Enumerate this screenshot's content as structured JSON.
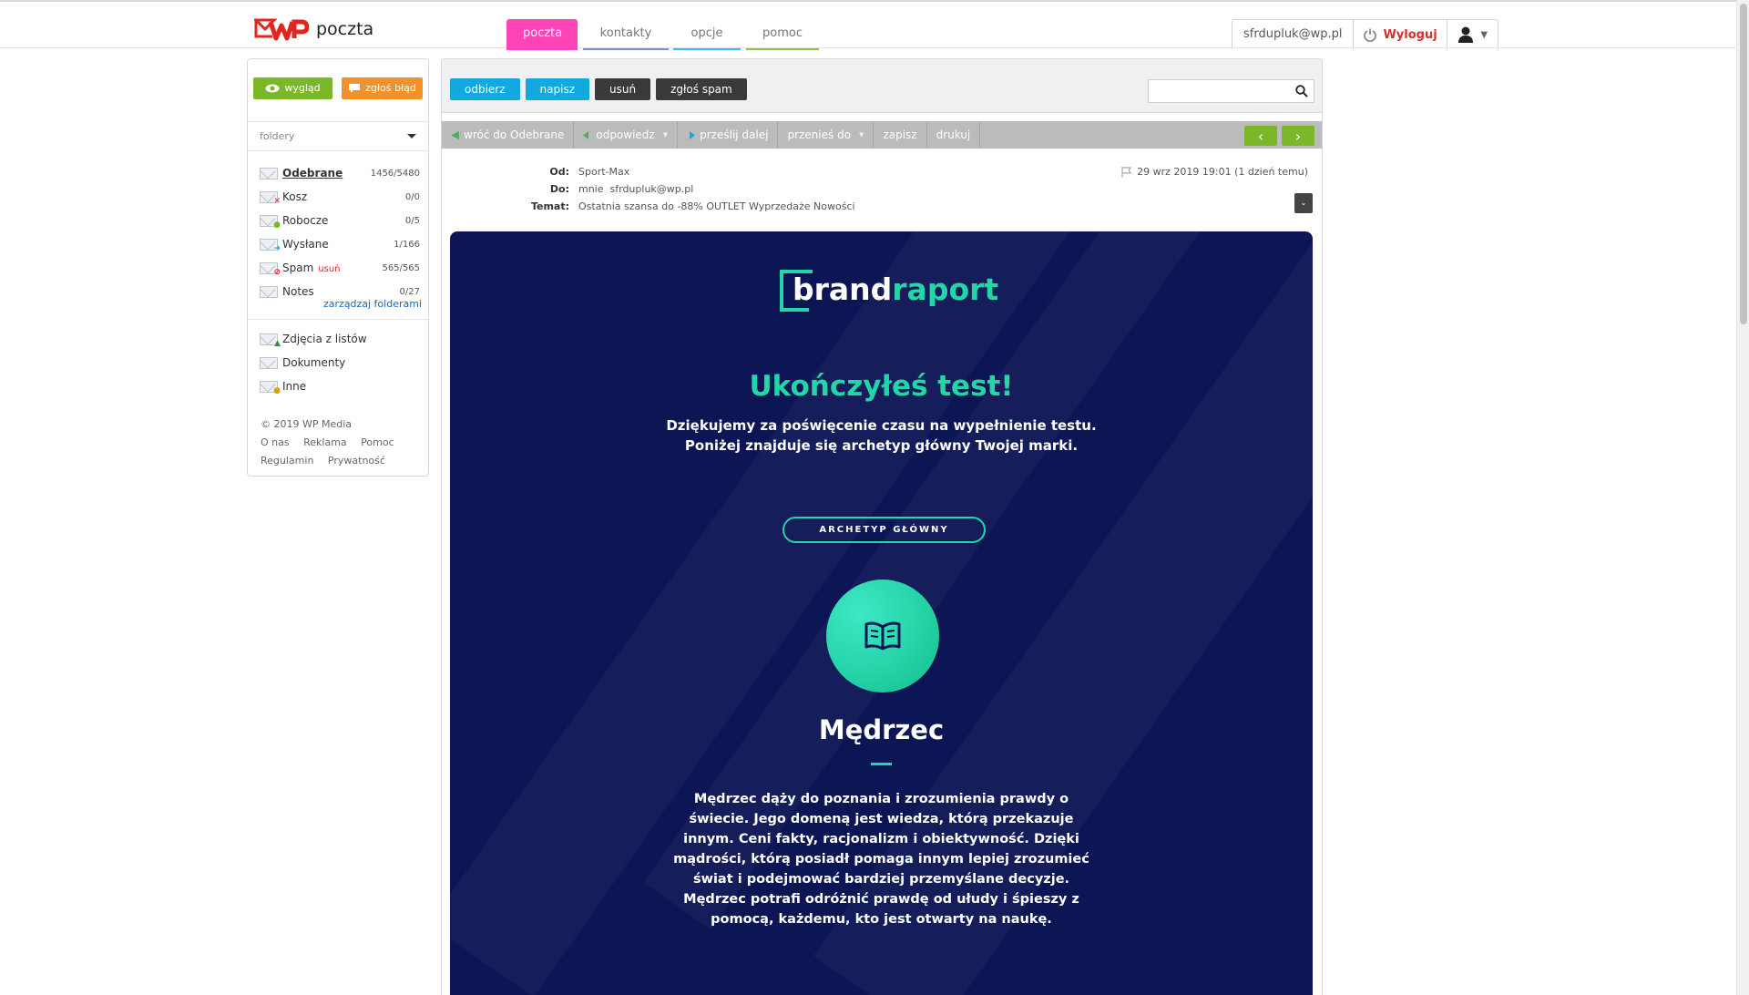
{
  "brand": {
    "name": "poczta"
  },
  "nav_tabs": [
    {
      "label": "poczta"
    },
    {
      "label": "kontakty"
    },
    {
      "label": "opcje"
    },
    {
      "label": "pomoc"
    }
  ],
  "account": {
    "email": "sfrdupluk@wp.pl",
    "logout_label": "Wyloguj"
  },
  "sidebar": {
    "view_button": "wygląd",
    "report_button": "zgłoś błąd",
    "folders_label": "foldery",
    "folders": [
      {
        "name": "Odebrane",
        "count": "1456/5480",
        "icon": "inbox-icon"
      },
      {
        "name": "Kosz",
        "count": "0/0",
        "icon": "trash-icon"
      },
      {
        "name": "Robocze",
        "count": "0/5",
        "icon": "drafts-icon"
      },
      {
        "name": "Wysłane",
        "count": "1/166",
        "icon": "sent-icon"
      },
      {
        "name": "Spam",
        "count": "565/565",
        "icon": "spam-icon",
        "action": "usuń"
      },
      {
        "name": "Notes",
        "count": "0/27",
        "icon": "notes-icon"
      }
    ],
    "manage_folders": "zarządzaj folderami",
    "extra_folders": [
      {
        "name": "Zdjęcia z listów",
        "icon": "photos-icon"
      },
      {
        "name": "Dokumenty",
        "icon": "documents-icon"
      },
      {
        "name": "Inne",
        "icon": "other-icon"
      }
    ],
    "copyright": "© 2019 WP Media",
    "footer_links": [
      "O nas",
      "Reklama",
      "Pomoc",
      "Regulamin",
      "Prywatność"
    ]
  },
  "toolbar": {
    "receive": "odbierz",
    "compose": "napisz",
    "delete": "usuń",
    "report_spam": "zgłoś spam",
    "search_placeholder": ""
  },
  "actions": {
    "back": "wróć do Odebrane",
    "reply": "odpowiedz",
    "forward": "prześlij dalej",
    "move": "przenieś do",
    "save": "zapisz",
    "print": "drukuj"
  },
  "message": {
    "from_label": "Od:",
    "from": "Sport-Max",
    "to_label": "Do:",
    "to_me": "mnie",
    "to_address": "sfrdupluk@wp.pl",
    "subject_label": "Temat:",
    "subject": "Ostatnia szansa do -88% OUTLET Wyprzedaże Nowości",
    "date": "29 wrz 2019 19:01 (1 dzień temu)"
  },
  "email_content": {
    "logo_part1": "brand",
    "logo_part2": "raport",
    "title": "Ukończyłeś test!",
    "subtitle": "Dziękujemy za poświęcenie czasu na wypełnienie testu. Poniżej znajduje się archetyp główny Twojej marki.",
    "pill": "ARCHETYP GŁÓWNY",
    "archetype": "Mędrzec",
    "description": "Mędrzec dąży do poznania i zrozumienia prawdy o świecie. Jego domeną jest wiedza, którą przekazuje innym. Ceni fakty, racjonalizm i obiektywność. Dzięki mądrości, którą posiadł pomaga innym lepiej zrozumieć świat i podejmować bardziej przemyślane decyzje. Mędrzec potrafi odróżnić prawdę od ułudy i śpieszy z pomocą, każdemu, kto jest otwarty na naukę."
  },
  "colors": {
    "tab_active": "#ff44b5",
    "green": "#7ab829",
    "orange": "#f3922b",
    "blue": "#12a9e1",
    "email_bg": "#0d1654",
    "email_accent": "#23d6a8",
    "logout": "#d0322d"
  }
}
